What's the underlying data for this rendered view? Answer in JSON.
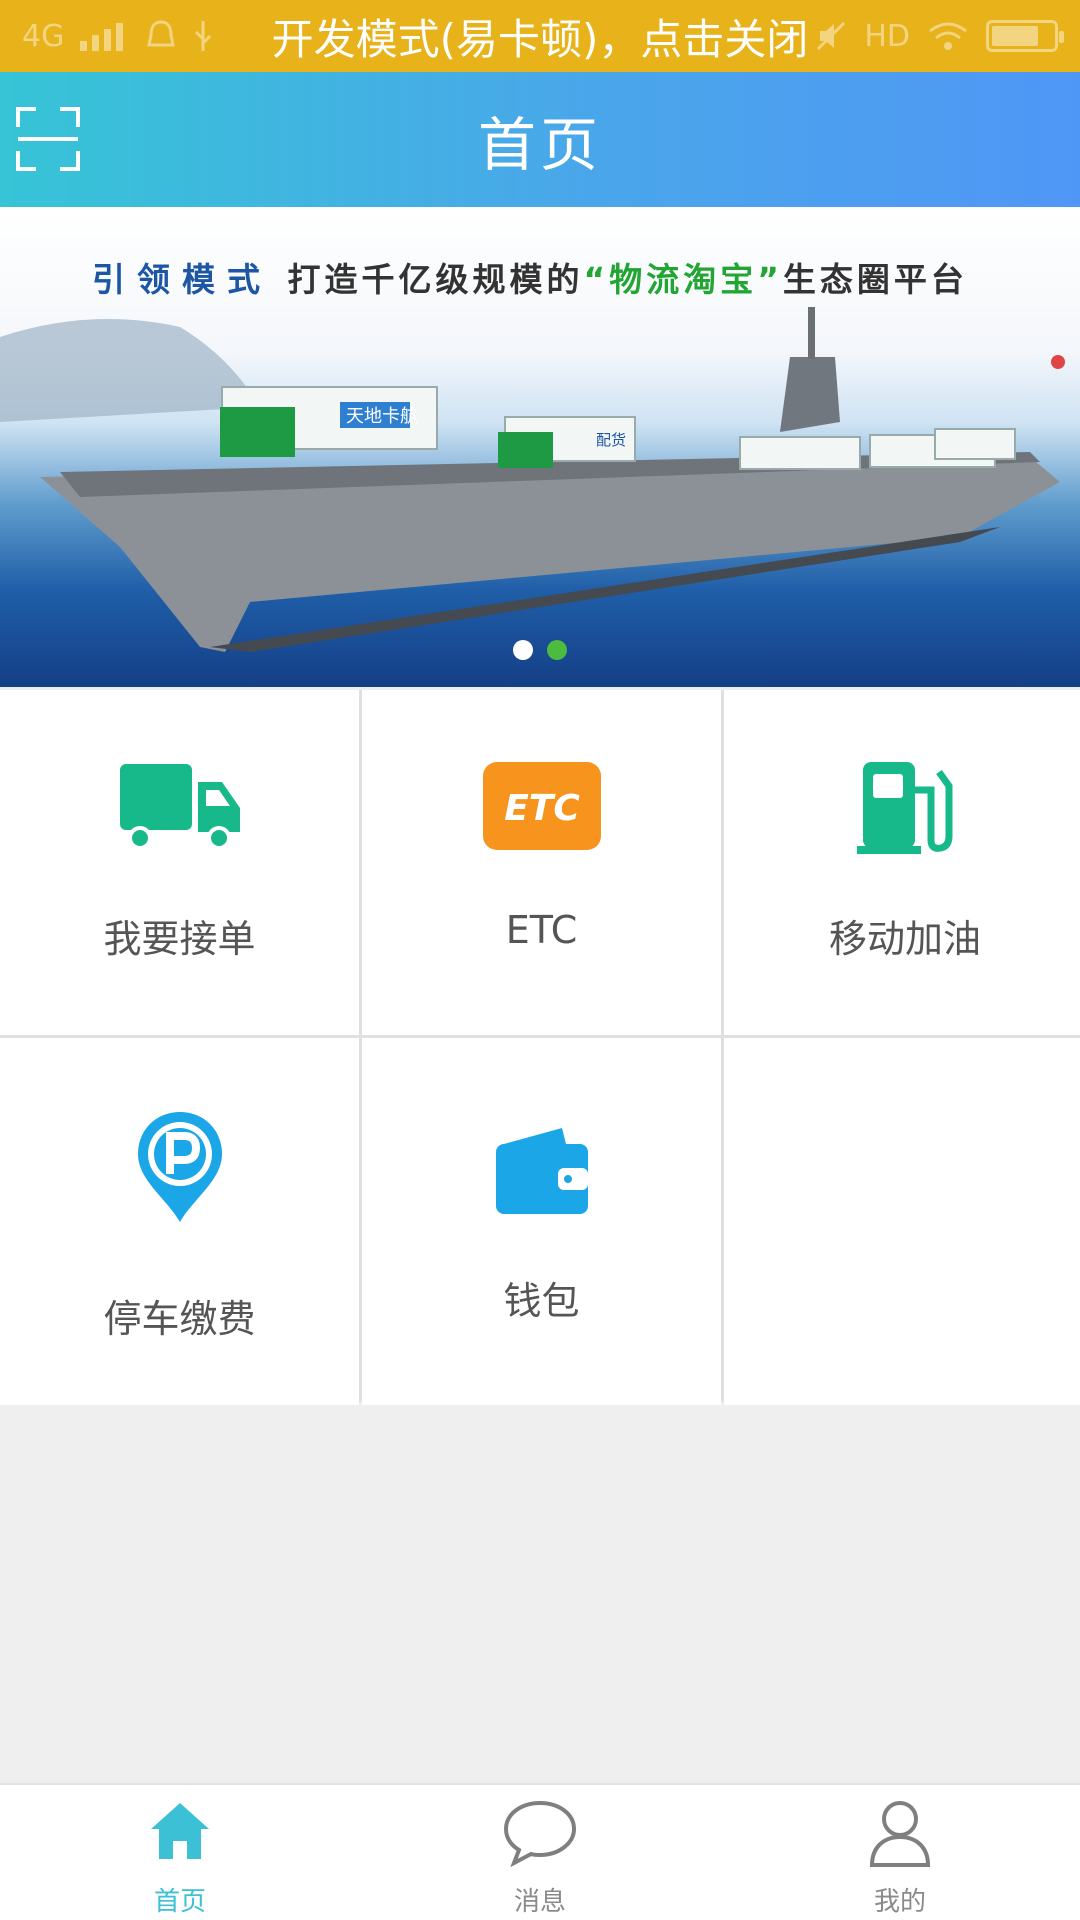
{
  "status_bar": {
    "dev_mode_text": "开发模式(易卡顿)，点击关闭",
    "network": "4G",
    "hd_label": "HD"
  },
  "header": {
    "title": "首页"
  },
  "banner": {
    "slogan_blue": "引领模式",
    "slogan_middle": "打造千亿级规模的",
    "slogan_green": "“物流淘宝”",
    "slogan_end": "生态圈平台",
    "truck_brand_1": "天地卡航",
    "truck_brand_2": "配货",
    "active_slide": 2,
    "slide_count": 2
  },
  "services": [
    {
      "label": "我要接单",
      "icon": "truck-icon",
      "color": "#17b98a"
    },
    {
      "label": "ETC",
      "icon": "etc-icon",
      "color": "#f7941d",
      "icon_text": "ETC"
    },
    {
      "label": "移动加油",
      "icon": "fuel-pump-icon",
      "color": "#17b98a"
    },
    {
      "label": "停车缴费",
      "icon": "parking-pin-icon",
      "color": "#1ba6e8"
    },
    {
      "label": "钱包",
      "icon": "wallet-icon",
      "color": "#1ba6e8"
    }
  ],
  "bottom_nav": [
    {
      "label": "首页",
      "icon": "home-icon",
      "active": true
    },
    {
      "label": "消息",
      "icon": "chat-bubble-icon",
      "active": false
    },
    {
      "label": "我的",
      "icon": "user-icon",
      "active": false
    }
  ],
  "colors": {
    "status_bar": "#e8b21a",
    "header_start": "#36c4d6",
    "header_end": "#4f97f6",
    "accent": "#3cc0d6",
    "inactive": "#8a8a8a"
  }
}
